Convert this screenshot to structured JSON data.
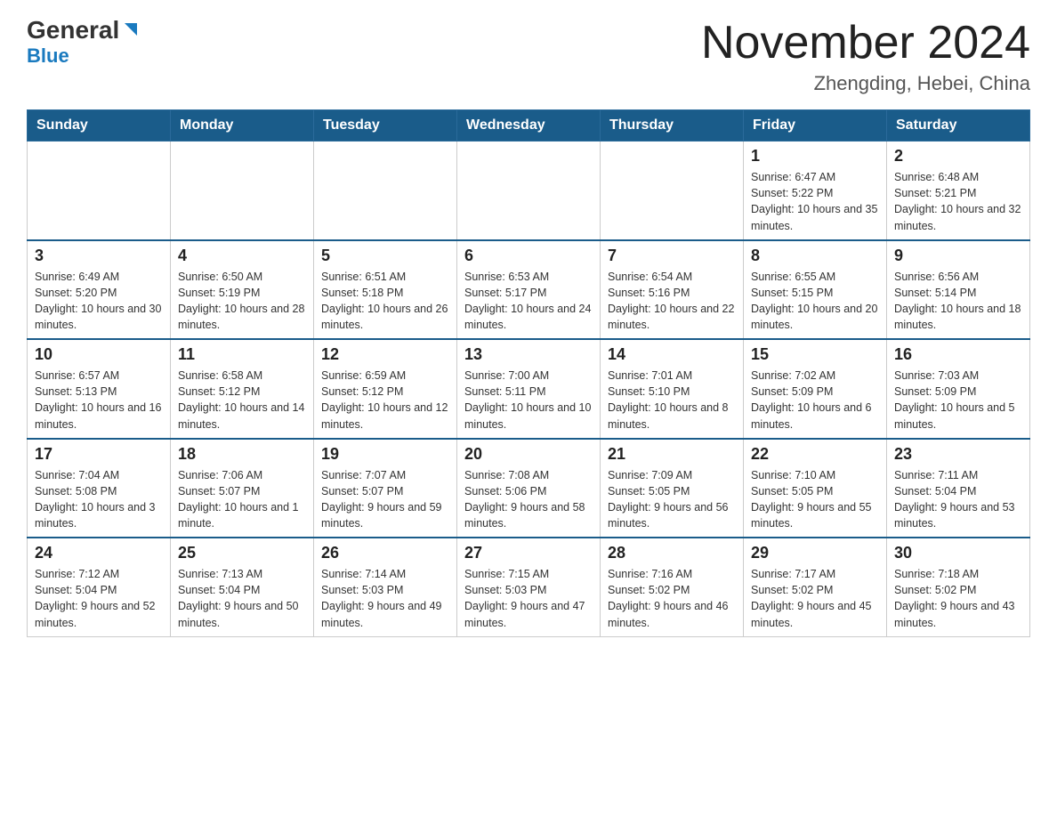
{
  "logo": {
    "general": "General",
    "blue": "Blue"
  },
  "title": {
    "month_year": "November 2024",
    "location": "Zhengding, Hebei, China"
  },
  "weekdays": [
    "Sunday",
    "Monday",
    "Tuesday",
    "Wednesday",
    "Thursday",
    "Friday",
    "Saturday"
  ],
  "weeks": [
    [
      {
        "day": "",
        "sunrise": "",
        "sunset": "",
        "daylight": ""
      },
      {
        "day": "",
        "sunrise": "",
        "sunset": "",
        "daylight": ""
      },
      {
        "day": "",
        "sunrise": "",
        "sunset": "",
        "daylight": ""
      },
      {
        "day": "",
        "sunrise": "",
        "sunset": "",
        "daylight": ""
      },
      {
        "day": "",
        "sunrise": "",
        "sunset": "",
        "daylight": ""
      },
      {
        "day": "1",
        "sunrise": "Sunrise: 6:47 AM",
        "sunset": "Sunset: 5:22 PM",
        "daylight": "Daylight: 10 hours and 35 minutes."
      },
      {
        "day": "2",
        "sunrise": "Sunrise: 6:48 AM",
        "sunset": "Sunset: 5:21 PM",
        "daylight": "Daylight: 10 hours and 32 minutes."
      }
    ],
    [
      {
        "day": "3",
        "sunrise": "Sunrise: 6:49 AM",
        "sunset": "Sunset: 5:20 PM",
        "daylight": "Daylight: 10 hours and 30 minutes."
      },
      {
        "day": "4",
        "sunrise": "Sunrise: 6:50 AM",
        "sunset": "Sunset: 5:19 PM",
        "daylight": "Daylight: 10 hours and 28 minutes."
      },
      {
        "day": "5",
        "sunrise": "Sunrise: 6:51 AM",
        "sunset": "Sunset: 5:18 PM",
        "daylight": "Daylight: 10 hours and 26 minutes."
      },
      {
        "day": "6",
        "sunrise": "Sunrise: 6:53 AM",
        "sunset": "Sunset: 5:17 PM",
        "daylight": "Daylight: 10 hours and 24 minutes."
      },
      {
        "day": "7",
        "sunrise": "Sunrise: 6:54 AM",
        "sunset": "Sunset: 5:16 PM",
        "daylight": "Daylight: 10 hours and 22 minutes."
      },
      {
        "day": "8",
        "sunrise": "Sunrise: 6:55 AM",
        "sunset": "Sunset: 5:15 PM",
        "daylight": "Daylight: 10 hours and 20 minutes."
      },
      {
        "day": "9",
        "sunrise": "Sunrise: 6:56 AM",
        "sunset": "Sunset: 5:14 PM",
        "daylight": "Daylight: 10 hours and 18 minutes."
      }
    ],
    [
      {
        "day": "10",
        "sunrise": "Sunrise: 6:57 AM",
        "sunset": "Sunset: 5:13 PM",
        "daylight": "Daylight: 10 hours and 16 minutes."
      },
      {
        "day": "11",
        "sunrise": "Sunrise: 6:58 AM",
        "sunset": "Sunset: 5:12 PM",
        "daylight": "Daylight: 10 hours and 14 minutes."
      },
      {
        "day": "12",
        "sunrise": "Sunrise: 6:59 AM",
        "sunset": "Sunset: 5:12 PM",
        "daylight": "Daylight: 10 hours and 12 minutes."
      },
      {
        "day": "13",
        "sunrise": "Sunrise: 7:00 AM",
        "sunset": "Sunset: 5:11 PM",
        "daylight": "Daylight: 10 hours and 10 minutes."
      },
      {
        "day": "14",
        "sunrise": "Sunrise: 7:01 AM",
        "sunset": "Sunset: 5:10 PM",
        "daylight": "Daylight: 10 hours and 8 minutes."
      },
      {
        "day": "15",
        "sunrise": "Sunrise: 7:02 AM",
        "sunset": "Sunset: 5:09 PM",
        "daylight": "Daylight: 10 hours and 6 minutes."
      },
      {
        "day": "16",
        "sunrise": "Sunrise: 7:03 AM",
        "sunset": "Sunset: 5:09 PM",
        "daylight": "Daylight: 10 hours and 5 minutes."
      }
    ],
    [
      {
        "day": "17",
        "sunrise": "Sunrise: 7:04 AM",
        "sunset": "Sunset: 5:08 PM",
        "daylight": "Daylight: 10 hours and 3 minutes."
      },
      {
        "day": "18",
        "sunrise": "Sunrise: 7:06 AM",
        "sunset": "Sunset: 5:07 PM",
        "daylight": "Daylight: 10 hours and 1 minute."
      },
      {
        "day": "19",
        "sunrise": "Sunrise: 7:07 AM",
        "sunset": "Sunset: 5:07 PM",
        "daylight": "Daylight: 9 hours and 59 minutes."
      },
      {
        "day": "20",
        "sunrise": "Sunrise: 7:08 AM",
        "sunset": "Sunset: 5:06 PM",
        "daylight": "Daylight: 9 hours and 58 minutes."
      },
      {
        "day": "21",
        "sunrise": "Sunrise: 7:09 AM",
        "sunset": "Sunset: 5:05 PM",
        "daylight": "Daylight: 9 hours and 56 minutes."
      },
      {
        "day": "22",
        "sunrise": "Sunrise: 7:10 AM",
        "sunset": "Sunset: 5:05 PM",
        "daylight": "Daylight: 9 hours and 55 minutes."
      },
      {
        "day": "23",
        "sunrise": "Sunrise: 7:11 AM",
        "sunset": "Sunset: 5:04 PM",
        "daylight": "Daylight: 9 hours and 53 minutes."
      }
    ],
    [
      {
        "day": "24",
        "sunrise": "Sunrise: 7:12 AM",
        "sunset": "Sunset: 5:04 PM",
        "daylight": "Daylight: 9 hours and 52 minutes."
      },
      {
        "day": "25",
        "sunrise": "Sunrise: 7:13 AM",
        "sunset": "Sunset: 5:04 PM",
        "daylight": "Daylight: 9 hours and 50 minutes."
      },
      {
        "day": "26",
        "sunrise": "Sunrise: 7:14 AM",
        "sunset": "Sunset: 5:03 PM",
        "daylight": "Daylight: 9 hours and 49 minutes."
      },
      {
        "day": "27",
        "sunrise": "Sunrise: 7:15 AM",
        "sunset": "Sunset: 5:03 PM",
        "daylight": "Daylight: 9 hours and 47 minutes."
      },
      {
        "day": "28",
        "sunrise": "Sunrise: 7:16 AM",
        "sunset": "Sunset: 5:02 PM",
        "daylight": "Daylight: 9 hours and 46 minutes."
      },
      {
        "day": "29",
        "sunrise": "Sunrise: 7:17 AM",
        "sunset": "Sunset: 5:02 PM",
        "daylight": "Daylight: 9 hours and 45 minutes."
      },
      {
        "day": "30",
        "sunrise": "Sunrise: 7:18 AM",
        "sunset": "Sunset: 5:02 PM",
        "daylight": "Daylight: 9 hours and 43 minutes."
      }
    ]
  ]
}
